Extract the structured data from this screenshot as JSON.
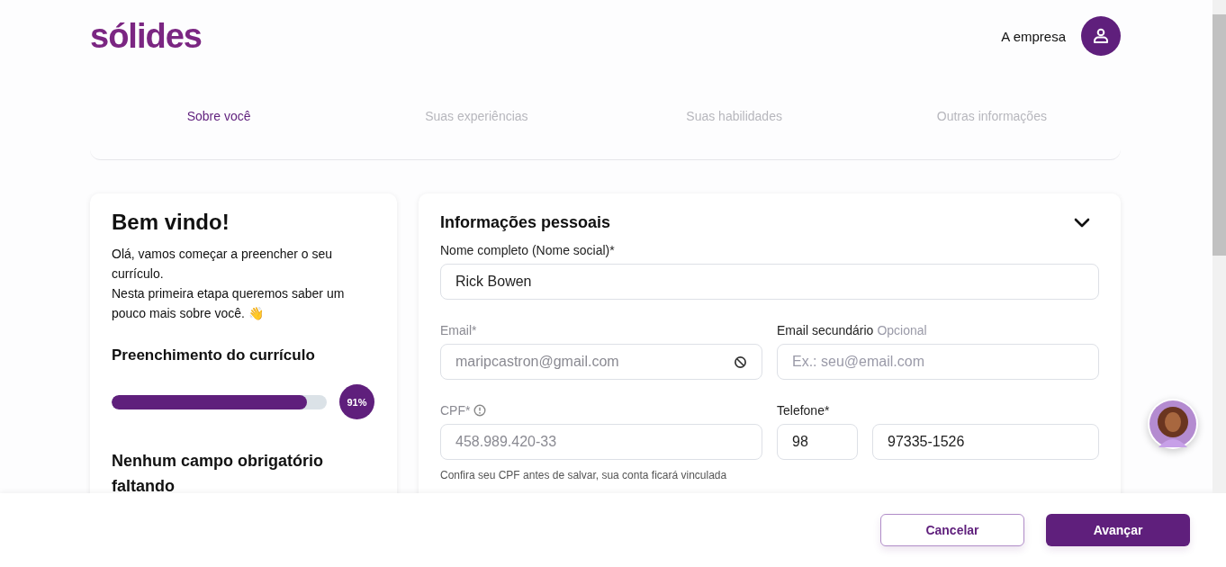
{
  "header": {
    "logo": "sólides",
    "company_link": "A empresa"
  },
  "steps": [
    {
      "label": "Sobre você",
      "selected": true
    },
    {
      "label": "Suas experiências",
      "selected": false
    },
    {
      "label": "Suas habilidades",
      "selected": false
    },
    {
      "label": "Outras informações",
      "selected": false
    }
  ],
  "welcome": {
    "title": "Bem vindo!",
    "paragraphs": [
      "Olá, vamos começar a preencher o seu currículo.",
      "Nesta primeira etapa queremos saber um pouco mais sobre você. 👋"
    ],
    "progress_title": "Preenchimento do currículo",
    "progress": {
      "level": 0.91,
      "reading": "91%"
    },
    "status": "Nenhum campo obrigatório faltando"
  },
  "personal": {
    "title": "Informações pessoais",
    "expanded": true,
    "name": {
      "label": "Nome completo (Nome social)*",
      "value": "Rick Bowen",
      "disabled": false
    },
    "email": {
      "label": "Email*",
      "value": "maripcastron@gmail.com",
      "disabled": true
    },
    "email2": {
      "label": "Email secundário",
      "optional": "Opcional",
      "placeholder": "Ex.: seu@email.com"
    },
    "cpf": {
      "label": "CPF*",
      "value": "458.989.420-33",
      "disabled": true,
      "hint": "Confira seu CPF antes de salvar, sua conta ficará vinculada"
    },
    "phone": {
      "label": "Telefone*",
      "area": "98",
      "number": "97335-1526"
    }
  },
  "footer": {
    "buttons": [
      {
        "label": "Cancelar",
        "kind": "secondary"
      },
      {
        "label": "Avançar",
        "kind": "primary"
      }
    ]
  }
}
